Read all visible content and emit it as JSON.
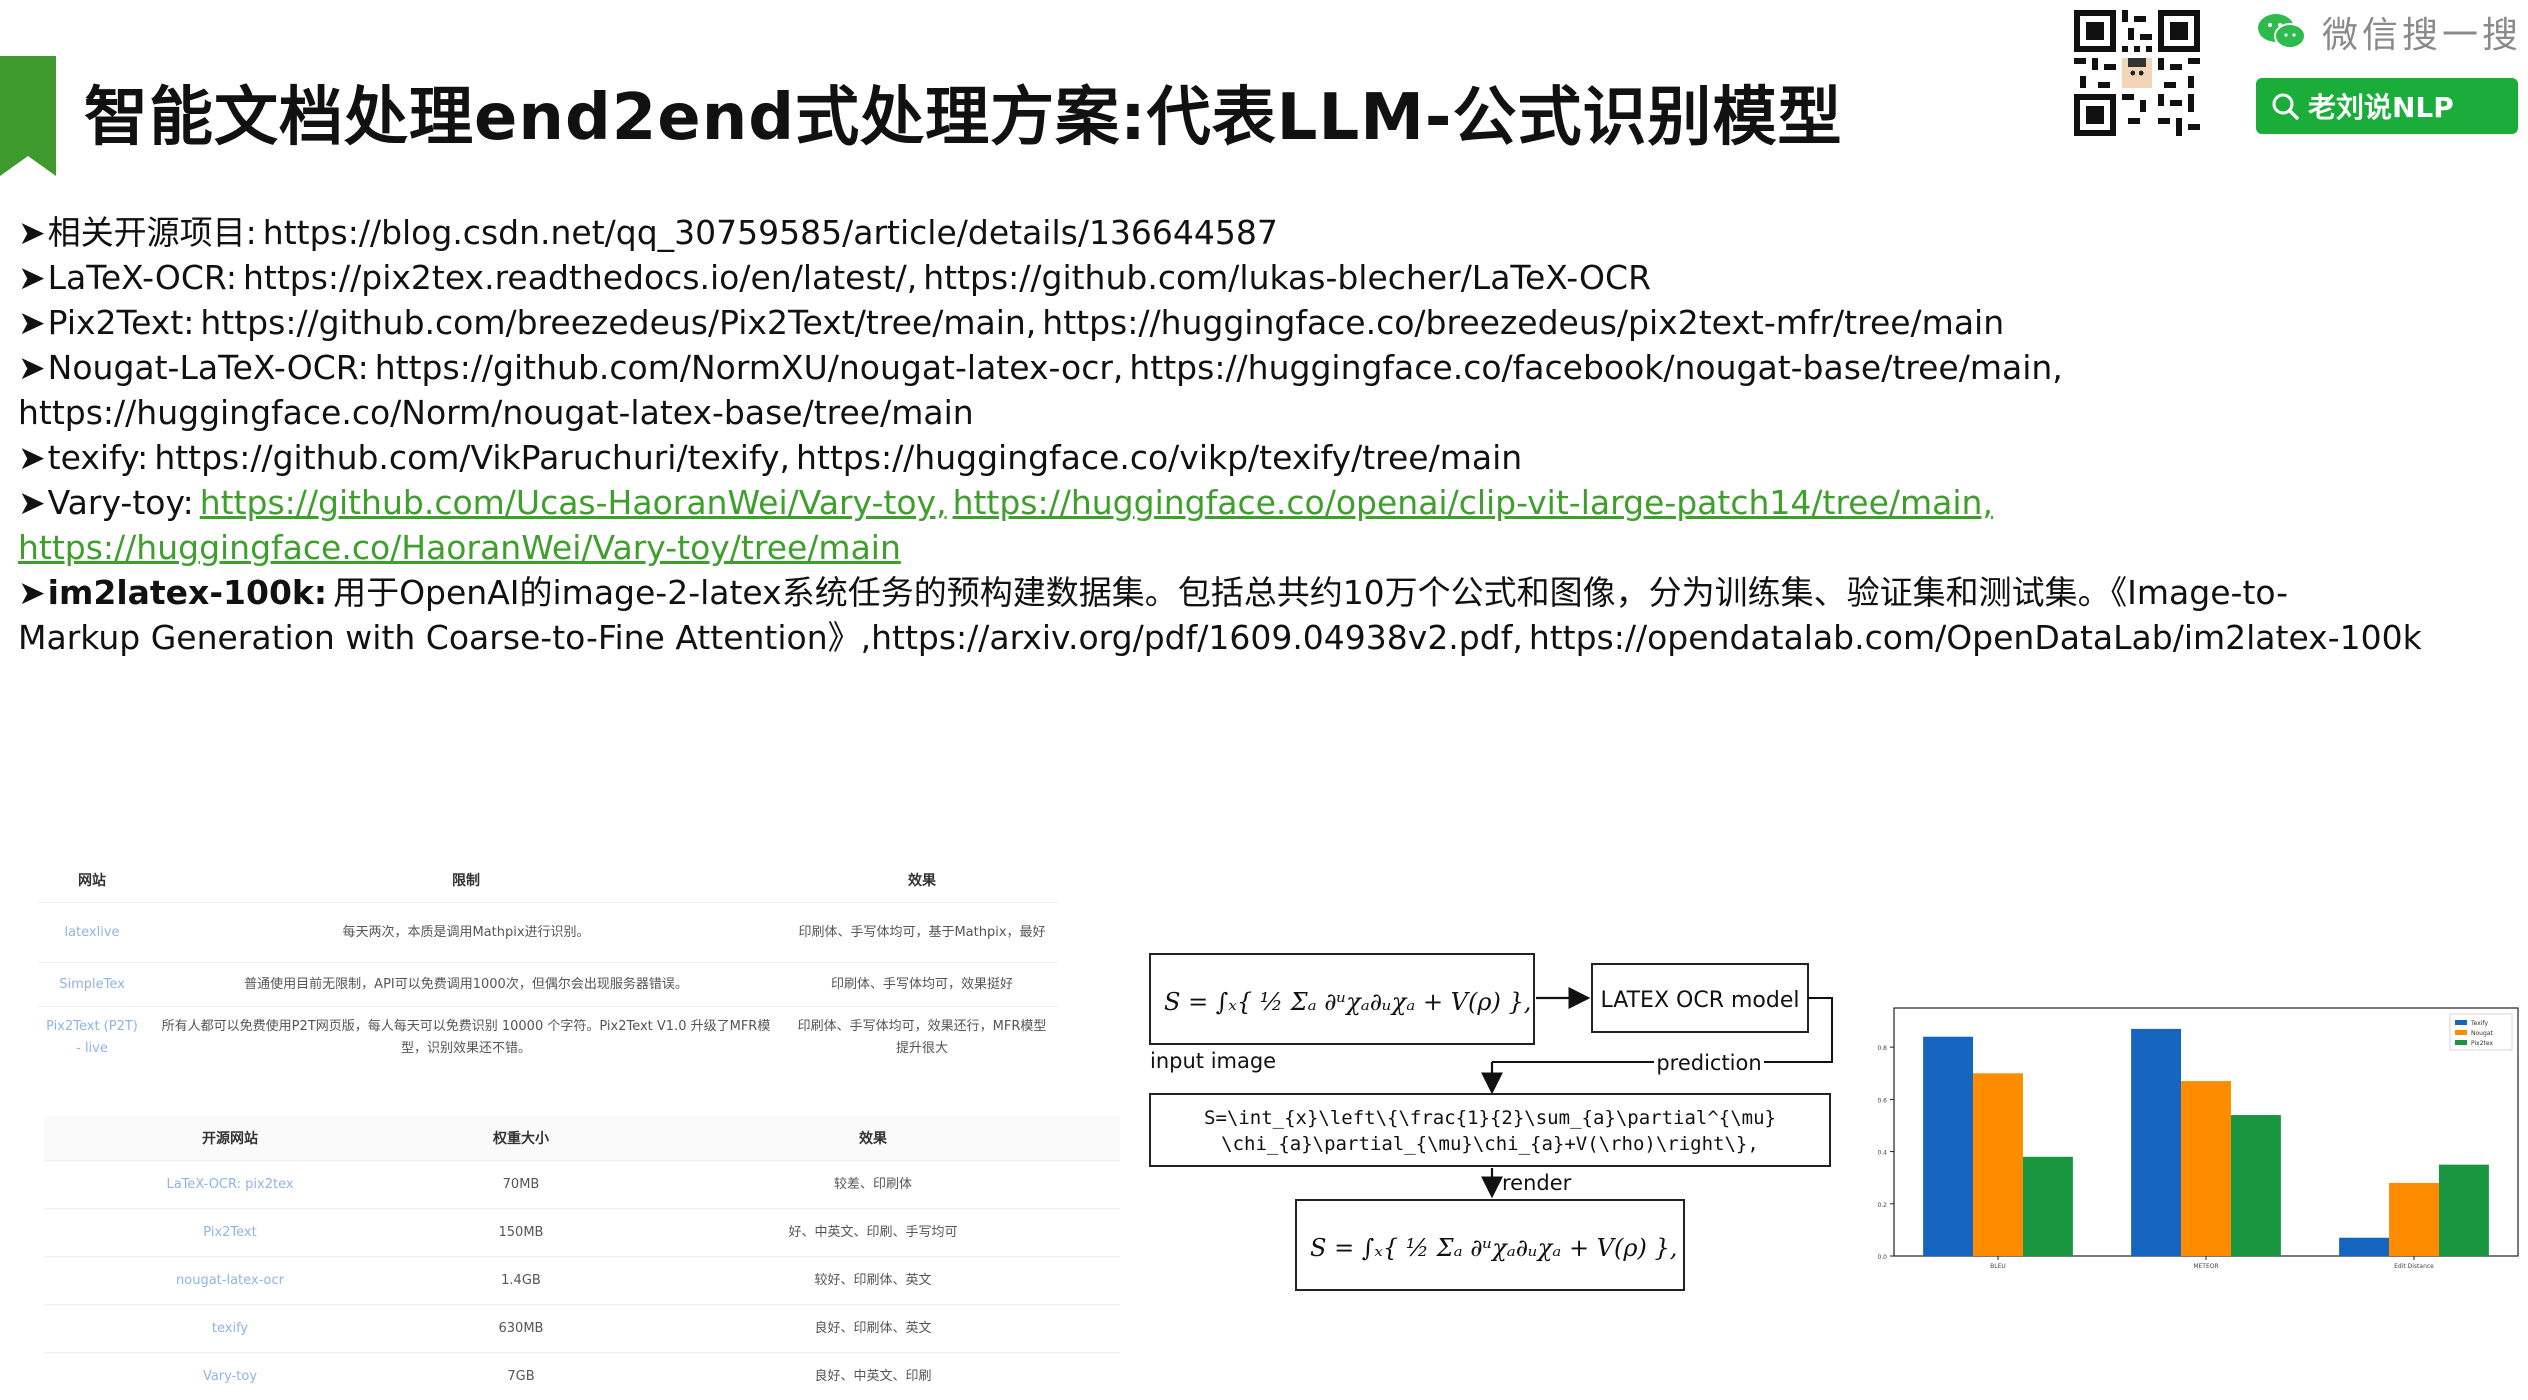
{
  "slide": {
    "title": "智能文档处理end2end式处理方案:代表LLM-公式识别模型",
    "accent_color": "#3f9a2e"
  },
  "wechat_badge": {
    "search_label": "微信搜一搜",
    "account_label": "老刘说NLP",
    "icons": [
      "wechat-icon",
      "search-icon",
      "qr-code-icon"
    ]
  },
  "links": [
    {
      "items": [
        {
          "text": "相关开源项目:",
          "style": ""
        },
        {
          "text": "https://blog.csdn.net/qq_30759585/article/details/136644587",
          "style": ""
        }
      ]
    },
    {
      "items": [
        {
          "text": "LaTeX-OCR:",
          "style": ""
        },
        {
          "text": "https://pix2tex.readthedocs.io/en/latest/,",
          "style": ""
        },
        {
          "text": "https://github.com/lukas-blecher/LaTeX-OCR",
          "style": ""
        }
      ]
    },
    {
      "items": [
        {
          "text": "Pix2Text:",
          "style": ""
        },
        {
          "text": "https://github.com/breezedeus/Pix2Text/tree/main,",
          "style": ""
        },
        {
          "text": "https://huggingface.co/breezedeus/pix2text-mfr/tree/main",
          "style": ""
        }
      ]
    },
    {
      "items": [
        {
          "text": "Nougat-LaTeX-OCR:",
          "style": ""
        },
        {
          "text": "https://github.com/NormXU/nougat-latex-ocr,",
          "style": ""
        },
        {
          "text": "https://huggingface.co/facebook/nougat-base/tree/main,",
          "style": ""
        }
      ]
    },
    {
      "cont": true,
      "items": [
        {
          "text": "https://huggingface.co/Norm/nougat-latex-base/tree/main",
          "style": ""
        }
      ]
    },
    {
      "items": [
        {
          "text": "texify:",
          "style": ""
        },
        {
          "text": "https://github.com/VikParuchuri/texify,",
          "style": ""
        },
        {
          "text": "https://huggingface.co/vikp/texify/tree/main",
          "style": ""
        }
      ]
    },
    {
      "items": [
        {
          "text": "Vary-toy:",
          "style": ""
        },
        {
          "text": "https://github.com/Ucas-HaoranWei/Vary-toy,",
          "style": "green"
        },
        {
          "text": "https://huggingface.co/openai/clip-vit-large-patch14/tree/main,",
          "style": "green"
        }
      ]
    },
    {
      "cont": true,
      "items": [
        {
          "text": "https://huggingface.co/HaoranWei/Vary-toy/tree/main",
          "style": "green"
        }
      ]
    },
    {
      "items": [
        {
          "text": "im2latex-100k:",
          "style": "bold"
        },
        {
          "text": "用于OpenAI的image-2-latex系统任务的预构建数据集。包括总共约10万个公式和图像，分为训练集、验证集和测试集。《Image-to-",
          "style": ""
        }
      ]
    },
    {
      "cont": true,
      "items": [
        {
          "text": "Markup Generation with Coarse-to-Fine Attention》,https://arxiv.org/pdf/1609.04938v2.pdf,",
          "style": ""
        },
        {
          "text": "https://opendatalab.com/OpenDataLab/im2latex-100k",
          "style": ""
        }
      ]
    }
  ],
  "table_websites": {
    "headers": [
      "网站",
      "限制",
      "效果"
    ],
    "rows": [
      [
        "latexlive",
        "每天两次，本质是调用Mathpix进行识别。",
        "印刷体、手写体均可，基于Mathpix，最好"
      ],
      [
        "SimpleTex",
        "普通使用目前无限制，API可以免费调用1000次，但偶尔会出现服务器错误。",
        "印刷体、手写体均可，效果挺好"
      ],
      [
        "Pix2Text (P2T) - live",
        "所有人都可以免费使用P2T网页版，每人每天可以免费识别 10000 个字符。Pix2Text V1.0 升级了MFR模型，识别效果还不错。",
        "印刷体、手写体均可，效果还行，MFR模型提升很大"
      ]
    ]
  },
  "table_opensource": {
    "headers": [
      "开源网站",
      "权重大小",
      "效果"
    ],
    "rows": [
      [
        "LaTeX-OCR: pix2tex",
        "70MB",
        "较差、印刷体"
      ],
      [
        "Pix2Text",
        "150MB",
        "好、中英文、印刷、手写均可"
      ],
      [
        "nougat-latex-ocr",
        "1.4GB",
        "较好、印刷体、英文"
      ],
      [
        "texify",
        "630MB",
        "良好、印刷体、英文"
      ],
      [
        "Vary-toy",
        "7GB",
        "良好、中英文、印刷"
      ]
    ]
  },
  "diagram": {
    "input_label": "input image",
    "model_label": "LATEX OCR model",
    "prediction_label": "prediction",
    "render_label": "render",
    "latex_line1": "S=\\int_{x}\\left\\{\\frac{1}{2}\\sum_{a}\\partial^{\\mu}",
    "latex_line2": "\\chi_{a}\\partial_{\\mu}\\chi_{a}+V(\\rho)\\right\\},"
  },
  "chart_data": {
    "type": "bar",
    "categories": [
      "BLEU",
      "METEOR",
      "Edit Distance"
    ],
    "series": [
      {
        "name": "Texify",
        "color": "#1565c0",
        "values": [
          0.84,
          0.87,
          0.07
        ]
      },
      {
        "name": "Nougat",
        "color": "#ff8c00",
        "values": [
          0.7,
          0.67,
          0.28
        ]
      },
      {
        "name": "Pix2tex",
        "color": "#1a9641",
        "values": [
          0.38,
          0.54,
          0.35
        ]
      }
    ],
    "ylim": [
      0,
      0.95
    ],
    "yticks": [
      "0.0",
      "0.2",
      "0.4",
      "0.6",
      "0.8"
    ],
    "legend": "top-right"
  }
}
